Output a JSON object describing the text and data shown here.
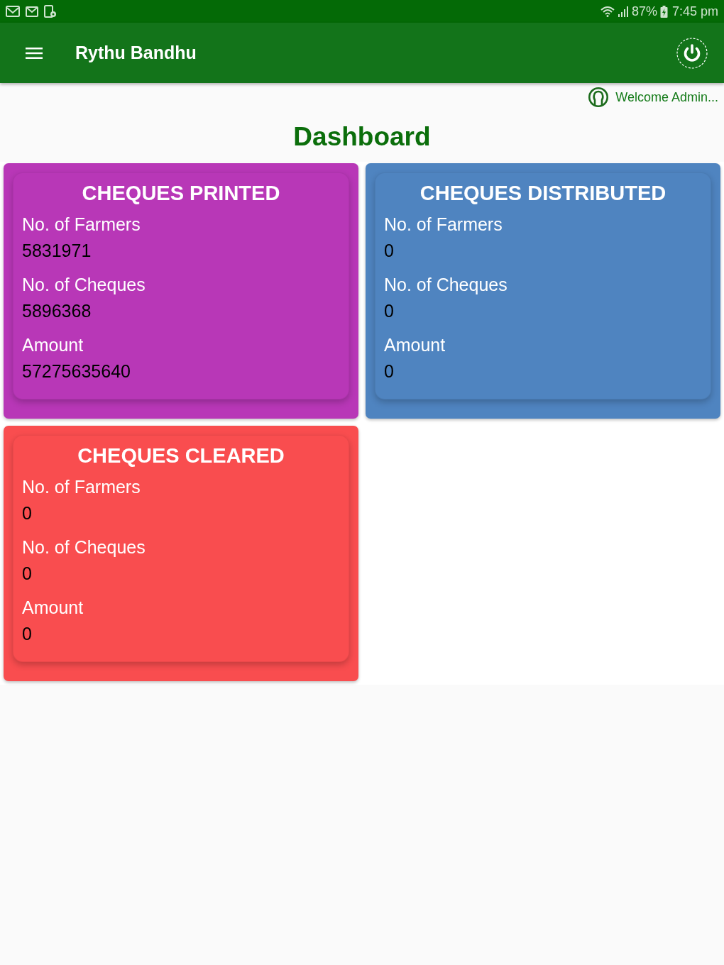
{
  "status_bar": {
    "battery": "87%",
    "time": "7:45 pm"
  },
  "app_bar": {
    "title": "Rythu Bandhu"
  },
  "welcome": "Welcome Admin...",
  "page_title": "Dashboard",
  "cards": [
    {
      "title": "CHEQUES PRINTED",
      "color": "#b837b7",
      "fields": [
        {
          "label": "No. of Farmers",
          "value": "5831971"
        },
        {
          "label": "No. of Cheques",
          "value": "5896368"
        },
        {
          "label": "Amount",
          "value": "57275635640"
        }
      ]
    },
    {
      "title": "CHEQUES DISTRIBUTED",
      "color": "#4f84c0",
      "fields": [
        {
          "label": "No. of Farmers",
          "value": "0"
        },
        {
          "label": "No. of Cheques",
          "value": "0"
        },
        {
          "label": "Amount",
          "value": "0"
        }
      ]
    },
    {
      "title": "CHEQUES CLEARED",
      "color": "#f94d4f",
      "fields": [
        {
          "label": "No. of Farmers",
          "value": "0"
        },
        {
          "label": "No. of Cheques",
          "value": "0"
        },
        {
          "label": "Amount",
          "value": "0"
        }
      ]
    }
  ]
}
